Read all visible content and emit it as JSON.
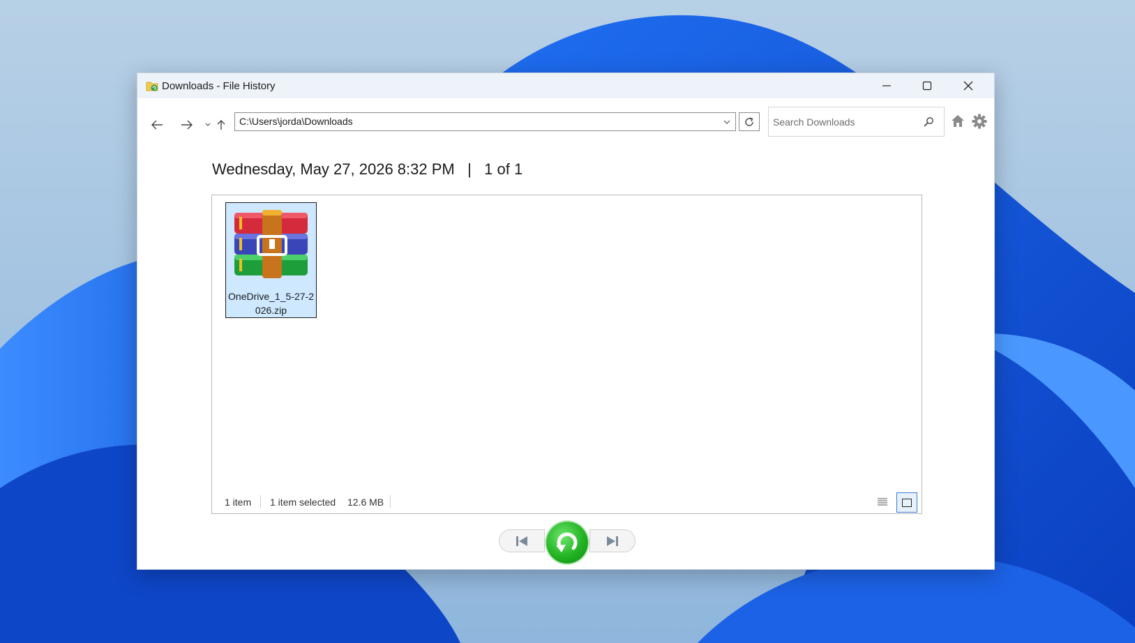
{
  "window": {
    "title": "Downloads - File History",
    "controls": {
      "minimize": "minimize-icon",
      "maximize": "maximize-icon",
      "close": "close-icon"
    }
  },
  "toolbar": {
    "address": "C:\\Users\\jorda\\Downloads",
    "search_placeholder": "Search Downloads",
    "icons": [
      "back-arrow-icon",
      "forward-arrow-icon",
      "recent-locations-icon",
      "up-arrow-icon",
      "refresh-icon",
      "search-icon",
      "home-icon",
      "gear-icon"
    ]
  },
  "heading": {
    "date": "Wednesday, May 27, 2026 8:32 PM",
    "separator": "|",
    "position": "1 of 1"
  },
  "files": [
    {
      "name": "OneDrive_1_5-27-2026.zip",
      "icon": "winrar-archive-icon",
      "selected": true
    }
  ],
  "status": {
    "item_count": "1 item",
    "selected": "1 item selected",
    "size": "12.6 MB"
  },
  "colors": {
    "selection_bg": "#cde8ff",
    "restore_green": "#22b322",
    "titlebar_bg": "#eef3f9"
  }
}
